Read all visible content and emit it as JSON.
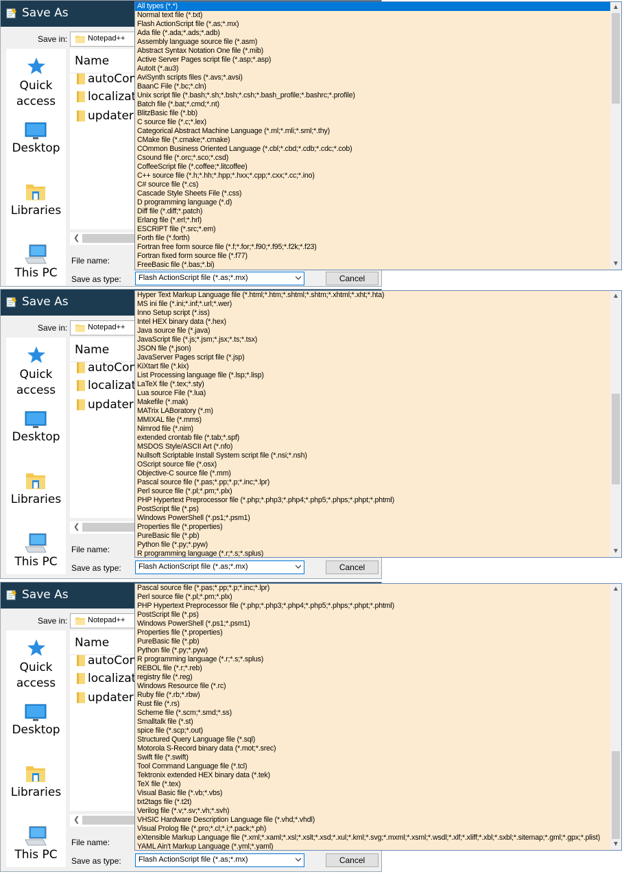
{
  "dialog": {
    "title": "Save As",
    "save_in_label": "Save in:",
    "save_in_value": "Notepad++",
    "column_name": "Name",
    "places": [
      "Quick access",
      "Desktop",
      "Libraries",
      "This PC"
    ],
    "files": [
      "autoCom",
      "localizatio",
      "updater"
    ],
    "file_name_label": "File name:",
    "save_as_type_label": "Save as type:",
    "save_as_type_value": "Flash ActionScript file (*.as;*.mx)",
    "cancel_label": "Cancel"
  },
  "panels": [
    {
      "selected_index": 0,
      "items": [
        "All types (*.*)",
        "Normal text file (*.txt)",
        "Flash ActionScript file (*.as;*.mx)",
        "Ada file (*.ada;*.ads;*.adb)",
        "Assembly language source file (*.asm)",
        "Abstract Syntax Notation One file (*.mib)",
        "Active Server Pages script file (*.asp;*.asp)",
        "AutoIt (*.au3)",
        "AviSynth scripts files (*.avs;*.avsi)",
        "BaanC File (*.bc;*.cln)",
        "Unix script file (*.bash;*.sh;*.bsh;*.csh;*.bash_profile;*.bashrc;*.profile)",
        "Batch file (*.bat;*.cmd;*.nt)",
        "BlitzBasic file (*.bb)",
        "C source file (*.c;*.lex)",
        "Categorical Abstract Machine Language (*.ml;*.mli;*.sml;*.thy)",
        "CMake file (*.cmake;*.cmake)",
        "COmmon Business Oriented Language (*.cbl;*.cbd;*.cdb;*.cdc;*.cob)",
        "Csound file (*.orc;*.sco;*.csd)",
        "CoffeeScript file (*.coffee;*.litcoffee)",
        "C++ source file (*.h;*.hh;*.hpp;*.hxx;*.cpp;*.cxx;*.cc;*.ino)",
        "C# source file (*.cs)",
        "Cascade Style Sheets File (*.css)",
        "D programming language (*.d)",
        "Diff file (*.diff;*.patch)",
        "Erlang file (*.erl;*.hrl)",
        "ESCRIPT file (*.src;*.em)",
        "Forth file (*.forth)",
        "Fortran free form source file (*.f;*.for;*.f90;*.f95;*.f2k;*.f23)",
        "Fortran fixed form source file (*.f77)",
        "FreeBasic file (*.bas;*.bi)"
      ]
    },
    {
      "selected_index": -1,
      "items": [
        "Hyper Text Markup Language file (*.html;*.htm;*.shtml;*.shtm;*.xhtml;*.xht;*.hta)",
        "MS ini file (*.ini;*.inf;*.url;*.wer)",
        "Inno Setup script (*.iss)",
        "Intel HEX binary data (*.hex)",
        "Java source file (*.java)",
        "JavaScript file (*.js;*.jsm;*.jsx;*.ts;*.tsx)",
        "JSON file (*.json)",
        "JavaServer Pages script file (*.jsp)",
        "KiXtart file (*.kix)",
        "List Processing language file (*.lsp;*.lisp)",
        "LaTeX file (*.tex;*.sty)",
        "Lua source File (*.lua)",
        "Makefile (*.mak)",
        "MATrix LABoratory (*.m)",
        "MMIXAL file (*.mms)",
        "Nimrod file (*.nim)",
        "extended crontab file (*.tab;*.spf)",
        "MSDOS Style/ASCII Art (*.nfo)",
        "Nullsoft Scriptable Install System script file (*.nsi;*.nsh)",
        "OScript source file (*.osx)",
        "Objective-C source file (*.mm)",
        "Pascal source file (*.pas;*.pp;*.p;*.inc;*.lpr)",
        "Perl source file (*.pl;*.pm;*.plx)",
        "PHP Hypertext Preprocessor file (*.php;*.php3;*.php4;*.php5;*.phps;*.phpt;*.phtml)",
        "PostScript file (*.ps)",
        "Windows PowerShell (*.ps1;*.psm1)",
        "Properties file (*.properties)",
        "PureBasic file (*.pb)",
        "Python file (*.py;*.pyw)",
        "R programming language (*.r;*.s;*.splus)"
      ]
    },
    {
      "selected_index": -1,
      "items": [
        "Pascal source file (*.pas;*.pp;*.p;*.inc;*.lpr)",
        "Perl source file (*.pl;*.pm;*.plx)",
        "PHP Hypertext Preprocessor file (*.php;*.php3;*.php4;*.php5;*.phps;*.phpt;*.phtml)",
        "PostScript file (*.ps)",
        "Windows PowerShell (*.ps1;*.psm1)",
        "Properties file (*.properties)",
        "PureBasic file (*.pb)",
        "Python file (*.py;*.pyw)",
        "R programming language (*.r;*.s;*.splus)",
        "REBOL file (*.r;*.reb)",
        "registry file (*.reg)",
        "Windows Resource file (*.rc)",
        "Ruby file (*.rb;*.rbw)",
        "Rust file (*.rs)",
        "Scheme file (*.scm;*.smd;*.ss)",
        "Smalltalk file (*.st)",
        "spice file (*.scp;*.out)",
        "Structured Query Language file (*.sql)",
        "Motorola S-Record binary data (*.mot;*.srec)",
        "Swift file (*.swift)",
        "Tool Command Language file (*.tcl)",
        "Tektronix extended HEX binary data (*.tek)",
        "TeX file (*.tex)",
        "Visual Basic file (*.vb;*.vbs)",
        "txt2tags file (*.t2t)",
        "Verilog file (*.v;*.sv;*.vh;*.svh)",
        "VHSIC Hardware Description Language file (*.vhd;*.vhdl)",
        "Visual Prolog file (*.pro;*.cl;*.i;*.pack;*.ph)",
        "eXtensible Markup Language file (*.xml;*.xaml;*.xsl;*.xslt;*.xsd;*.xul;*.kml;*.svg;*.mxml;*.xsml;*.wsdl;*.xlf;*.xliff;*.xbl;*.sxbl;*.sitemap;*.gml;*.gpx;*.plist)",
        "YAML Ain't Markup Language (*.yml;*.yaml)"
      ]
    }
  ]
}
